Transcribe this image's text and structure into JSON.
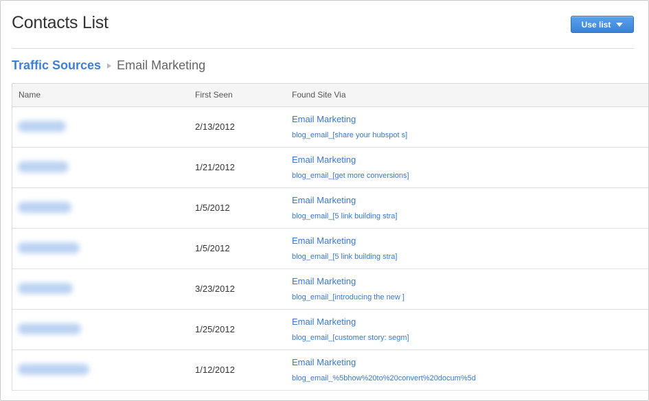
{
  "page": {
    "title": "Contacts List",
    "use_list_button": "Use list"
  },
  "breadcrumb": {
    "parent": "Traffic Sources",
    "current": "Email Marketing"
  },
  "table": {
    "columns": [
      "Name",
      "First Seen",
      "Found Site Via"
    ],
    "rows": [
      {
        "first_seen": "2/13/2012",
        "source": "Email Marketing",
        "detail": "blog_email_[share your hubspot s]"
      },
      {
        "first_seen": "1/21/2012",
        "source": "Email Marketing",
        "detail": "blog_email_[get more conversions]"
      },
      {
        "first_seen": "1/5/2012",
        "source": "Email Marketing",
        "detail": "blog_email_[5 link building stra]"
      },
      {
        "first_seen": "1/5/2012",
        "source": "Email Marketing",
        "detail": "blog_email_[5 link building stra]"
      },
      {
        "first_seen": "3/23/2012",
        "source": "Email Marketing",
        "detail": "blog_email_[introducing the new ]"
      },
      {
        "first_seen": "1/25/2012",
        "source": "Email Marketing",
        "detail": "blog_email_[customer story: segm]"
      },
      {
        "first_seen": "1/12/2012",
        "source": "Email Marketing",
        "detail": "blog_email_%5bhow%20to%20convert%20docum%5d"
      }
    ]
  },
  "colors": {
    "link": "#3a78c9",
    "breadcrumb_link": "#3f7fd6",
    "button": "#3a82d6",
    "redacted_name": "#aecaf0"
  }
}
